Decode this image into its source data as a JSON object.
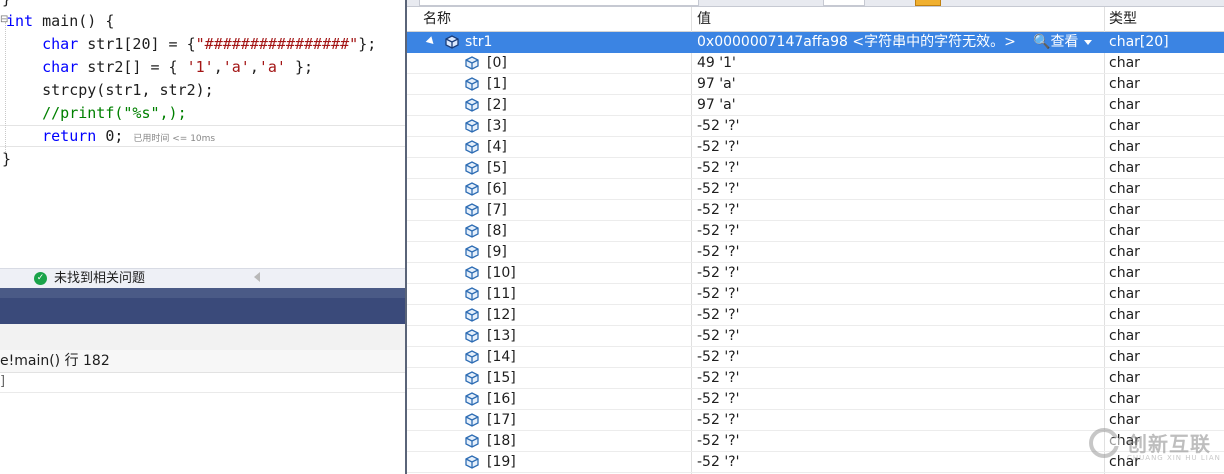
{
  "editor": {
    "lines": [
      {
        "tokens": [
          {
            "t": "}",
            "c": "plain"
          }
        ]
      },
      {
        "tokens": [
          {
            "t": "int",
            "c": "ty"
          },
          {
            "t": " main() {",
            "c": "plain"
          }
        ]
      },
      {
        "tokens": [
          {
            "t": "    char",
            "c": "ty"
          },
          {
            "t": " str1[20] = {",
            "c": "plain"
          },
          {
            "t": "\"################\"",
            "c": "str"
          },
          {
            "t": "};",
            "c": "plain"
          }
        ]
      },
      {
        "tokens": [
          {
            "t": "    char",
            "c": "ty"
          },
          {
            "t": " str2[] = { ",
            "c": "plain"
          },
          {
            "t": "'1'",
            "c": "str"
          },
          {
            "t": ",",
            "c": "plain"
          },
          {
            "t": "'a'",
            "c": "str"
          },
          {
            "t": ",",
            "c": "plain"
          },
          {
            "t": "'a'",
            "c": "str"
          },
          {
            "t": " };",
            "c": "plain"
          }
        ]
      },
      {
        "tokens": [
          {
            "t": "    strcpy(str1, str2);",
            "c": "plain"
          }
        ]
      },
      {
        "tokens": [
          {
            "t": "    //printf(\"%s\",);",
            "c": "cm"
          }
        ]
      },
      {
        "tokens": [
          {
            "t": "    return",
            "c": "kw"
          },
          {
            "t": " 0;",
            "c": "plain"
          }
        ]
      },
      {
        "tokens": [
          {
            "t": "}",
            "c": "plain"
          }
        ]
      }
    ],
    "elapsed_hint": "已用时间 <= 10ms"
  },
  "status": {
    "text": "未找到相关问题"
  },
  "callstack": {
    "frame": "e!main() 行 182",
    "frame2": "]"
  },
  "watch": {
    "headers": {
      "name": "名称",
      "value": "值",
      "type": "类型"
    },
    "root": {
      "name": "str1",
      "value": "0x0000007147affa98 <字符串中的字符无效。>",
      "view_label": "查看",
      "type": "char[20]"
    },
    "items": [
      {
        "name": "[0]",
        "value": "49 '1'",
        "type": "char"
      },
      {
        "name": "[1]",
        "value": "97 'a'",
        "type": "char"
      },
      {
        "name": "[2]",
        "value": "97 'a'",
        "type": "char"
      },
      {
        "name": "[3]",
        "value": "-52 '?'",
        "type": "char"
      },
      {
        "name": "[4]",
        "value": "-52 '?'",
        "type": "char"
      },
      {
        "name": "[5]",
        "value": "-52 '?'",
        "type": "char"
      },
      {
        "name": "[6]",
        "value": "-52 '?'",
        "type": "char"
      },
      {
        "name": "[7]",
        "value": "-52 '?'",
        "type": "char"
      },
      {
        "name": "[8]",
        "value": "-52 '?'",
        "type": "char"
      },
      {
        "name": "[9]",
        "value": "-52 '?'",
        "type": "char"
      },
      {
        "name": "[10]",
        "value": "-52 '?'",
        "type": "char"
      },
      {
        "name": "[11]",
        "value": "-52 '?'",
        "type": "char"
      },
      {
        "name": "[12]",
        "value": "-52 '?'",
        "type": "char"
      },
      {
        "name": "[13]",
        "value": "-52 '?'",
        "type": "char"
      },
      {
        "name": "[14]",
        "value": "-52 '?'",
        "type": "char"
      },
      {
        "name": "[15]",
        "value": "-52 '?'",
        "type": "char"
      },
      {
        "name": "[16]",
        "value": "-52 '?'",
        "type": "char"
      },
      {
        "name": "[17]",
        "value": "-52 '?'",
        "type": "char"
      },
      {
        "name": "[18]",
        "value": "-52 '?'",
        "type": "char"
      },
      {
        "name": "[19]",
        "value": "-52 '?'",
        "type": "char"
      }
    ]
  },
  "watermark": {
    "title": "创新互联",
    "subtitle": "CHUANG XIN HU LIAN"
  },
  "colors": {
    "selection": "#3b84e3",
    "keyword": "#0000ff",
    "string": "#a31515",
    "comment": "#008000",
    "ok_green": "#1aa34a"
  }
}
